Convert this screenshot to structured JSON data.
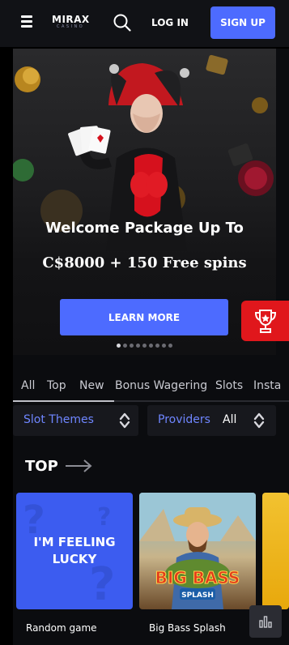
{
  "header": {
    "logo_text": "MIRAX",
    "logo_sub": "CASINO",
    "login_label": "LOG IN",
    "signup_label": "SIGN UP",
    "icons": [
      "menu-icon",
      "search-icon"
    ]
  },
  "hero": {
    "title": "Welcome Package Up To",
    "subtitle": "C$8000 + 150 Free spins",
    "cta_label": "LEARN MORE",
    "slides_total": 9,
    "slide_active": 1
  },
  "side_tab": {
    "icon": "trophy-icon"
  },
  "categories": [
    {
      "label": "All",
      "active": true
    },
    {
      "label": "Top"
    },
    {
      "label": "New"
    },
    {
      "label": "Bonus Wagering"
    },
    {
      "label": "Slots"
    },
    {
      "label": "Insta"
    }
  ],
  "filters": {
    "themes_label": "Slot Themes",
    "providers_label": "Providers",
    "providers_value": "All"
  },
  "section": {
    "title": "TOP",
    "games": [
      {
        "name": "Random game",
        "tile_text": "I'M FEELING LUCKY"
      },
      {
        "name": "Big Bass Splash",
        "tile_text_1": "BIG BASS",
        "tile_text_2": "SPLASH"
      }
    ]
  },
  "colors": {
    "accent": "#4d6bff",
    "link": "#6f86ff",
    "trophy_tab": "#e0171c",
    "background": "#000000",
    "header": "#111216"
  }
}
